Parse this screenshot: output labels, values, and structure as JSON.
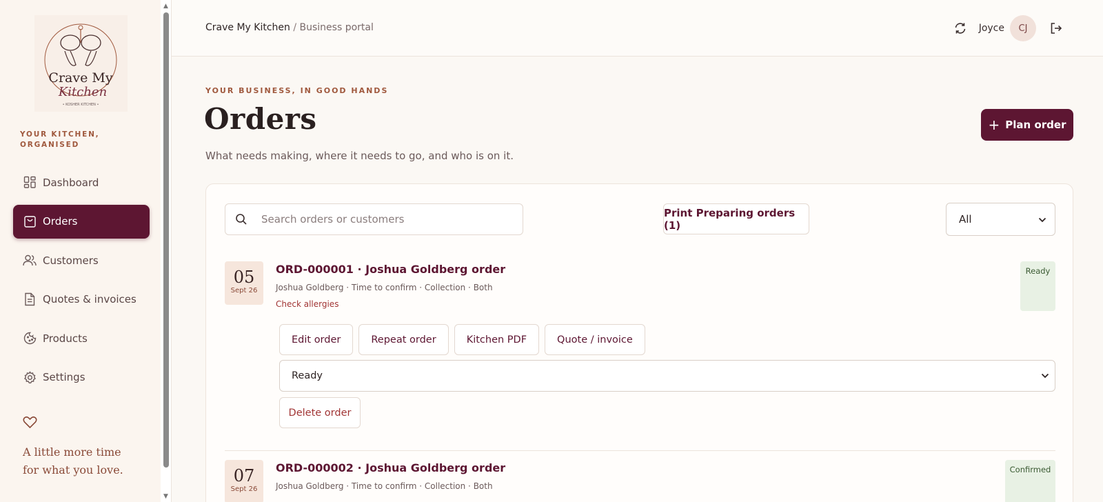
{
  "brand": {
    "logo_line1": "Crave My",
    "logo_line2": "Kitchen",
    "logo_small": "• KOSHER KITCHEN •",
    "tagline": "YOUR KITCHEN, ORGANISED"
  },
  "nav": [
    {
      "label": "Dashboard",
      "icon": "dashboard-icon"
    },
    {
      "label": "Orders",
      "icon": "shopping-bag-icon",
      "active": true
    },
    {
      "label": "Customers",
      "icon": "users-icon"
    },
    {
      "label": "Quotes & invoices",
      "icon": "document-icon"
    },
    {
      "label": "Products",
      "icon": "cookie-icon"
    },
    {
      "label": "Settings",
      "icon": "gear-icon"
    }
  ],
  "sidebar_quote": {
    "line1": "A little more time",
    "line2": "for what you love."
  },
  "header": {
    "breadcrumb_root": "Crave My Kitchen",
    "breadcrumb_sep": "/",
    "breadcrumb_sub": "Business portal",
    "user_name": "Joyce",
    "avatar_initials": "CJ"
  },
  "page": {
    "eyebrow": "YOUR BUSINESS, IN GOOD HANDS",
    "title": "Orders",
    "subtitle": "What needs making, where it needs to go, and who is on it.",
    "plan_button": "Plan order",
    "plan_plus": "+"
  },
  "toolbar": {
    "search_placeholder": "Search orders or customers",
    "print_button": "Print Preparing orders (1)",
    "filter_value": "All"
  },
  "orders": [
    {
      "day": "05",
      "month": "Sept 26",
      "title": "ORD-000001 · Joshua Goldberg order",
      "meta": "Joshua Goldberg · Time to confirm · Collection · Both",
      "warning": "Check allergies",
      "status": "Ready",
      "actions": [
        "Edit order",
        "Repeat order",
        "Kitchen PDF",
        "Quote / invoice"
      ],
      "status_select": "Ready",
      "delete": "Delete order"
    },
    {
      "day": "07",
      "month": "Sept 26",
      "title": "ORD-000002 · Joshua Goldberg order",
      "meta": "Joshua Goldberg · Time to confirm · Collection · Both",
      "status": "Confirmed"
    }
  ],
  "colors": {
    "accent": "#5d1632",
    "eyebrow": "#a0593e",
    "ready_bg": "#e8f1e4"
  }
}
